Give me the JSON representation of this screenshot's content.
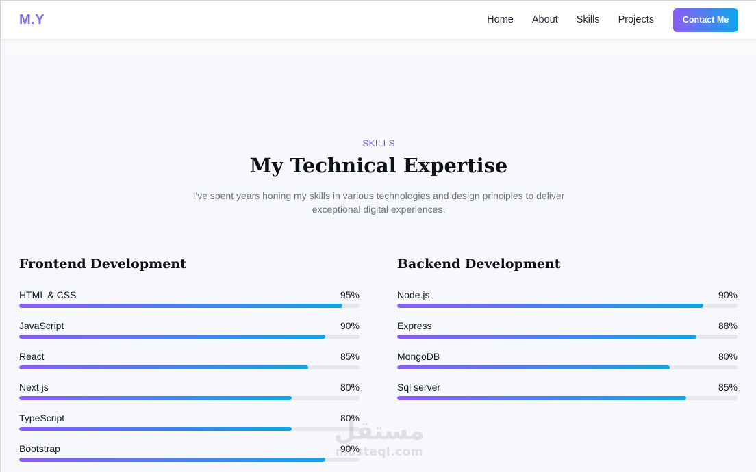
{
  "nav": {
    "logo": "M.Y",
    "links": [
      "Home",
      "About",
      "Skills",
      "Projects"
    ],
    "contact_label": "Contact Me"
  },
  "header": {
    "eyebrow": "SKILLS",
    "title": "My Technical Expertise",
    "description": "I've spent years honing my skills in various technologies and design principles to deliver exceptional digital experiences."
  },
  "frontend": {
    "title": "Frontend Development",
    "skills": [
      {
        "name": "HTML & CSS",
        "pct_label": "95%",
        "value": 95
      },
      {
        "name": "JavaScript",
        "pct_label": "90%",
        "value": 90
      },
      {
        "name": "React",
        "pct_label": "85%",
        "value": 85
      },
      {
        "name": "Next js",
        "pct_label": "80%",
        "value": 80
      },
      {
        "name": "TypeScript",
        "pct_label": "80%",
        "value": 80
      },
      {
        "name": "Bootstrap",
        "pct_label": "90%",
        "value": 90
      }
    ]
  },
  "backend": {
    "title": "Backend Development",
    "skills": [
      {
        "name": "Node.js",
        "pct_label": "90%",
        "value": 90
      },
      {
        "name": "Express",
        "pct_label": "88%",
        "value": 88
      },
      {
        "name": "MongoDB",
        "pct_label": "80%",
        "value": 80
      },
      {
        "name": "Sql server",
        "pct_label": "85%",
        "value": 85
      }
    ]
  },
  "watermark": {
    "arabic": "مستقل",
    "latin": "mostaql.com"
  },
  "colors": {
    "accent_start": "#8b5cf6",
    "accent_end": "#0ea5e9",
    "eyebrow": "#7c5cf0"
  }
}
